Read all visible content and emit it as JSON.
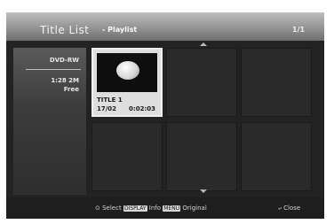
{
  "screen": {
    "title": "Title List",
    "subtitle": "- Playlist",
    "page": "1/1"
  },
  "disc_info": {
    "type": "DVD-RW",
    "space": "1:28 2M",
    "free_label": "Free"
  },
  "titles": [
    {
      "name": "TITLE 1",
      "date": "17/02",
      "duration": "0:02:03",
      "selected": true
    }
  ],
  "footer": {
    "select_label": "Select",
    "display_key": "DISPLAY",
    "info_label": "Info",
    "menu_key": "MENU",
    "original_label": "Original",
    "close_label": "Close"
  }
}
